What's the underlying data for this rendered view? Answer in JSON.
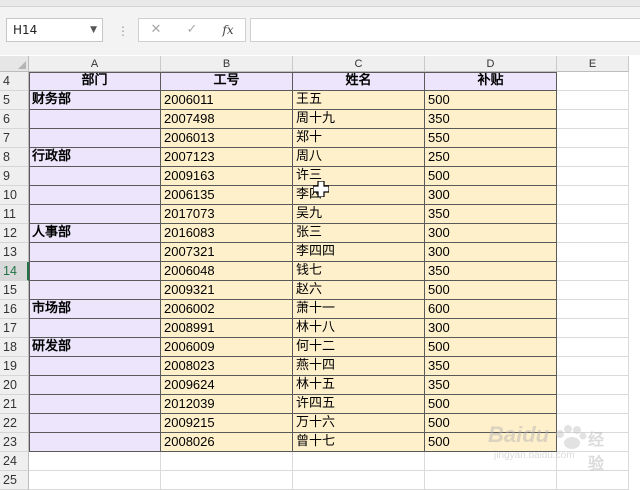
{
  "formula_bar": {
    "name_box": "H14",
    "separator": "⋮",
    "cancel_icon": "close-icon",
    "enter_icon": "check-icon",
    "fx_label": "fx",
    "formula_value": ""
  },
  "columns": [
    "A",
    "B",
    "C",
    "D",
    "E"
  ],
  "rows": [
    "4",
    "5",
    "6",
    "7",
    "8",
    "9",
    "10",
    "11",
    "12",
    "13",
    "14",
    "15",
    "16",
    "17",
    "18",
    "19",
    "20",
    "21",
    "22",
    "23",
    "24",
    "25"
  ],
  "selected_row": "14",
  "table": {
    "headers": [
      "部门",
      "工号",
      "姓名",
      "补贴"
    ],
    "records": [
      {
        "dept": "财务部",
        "id": "2006011",
        "name": "王五",
        "amount": "500"
      },
      {
        "dept": "",
        "id": "2007498",
        "name": "周十九",
        "amount": "350"
      },
      {
        "dept": "",
        "id": "2006013",
        "name": "郑十",
        "amount": "550"
      },
      {
        "dept": "行政部",
        "id": "2007123",
        "name": "周八",
        "amount": "250"
      },
      {
        "dept": "",
        "id": "2009163",
        "name": "许三",
        "amount": "500"
      },
      {
        "dept": "",
        "id": "2006135",
        "name": "李四",
        "amount": "300"
      },
      {
        "dept": "",
        "id": "2017073",
        "name": "吴九",
        "amount": "350"
      },
      {
        "dept": "人事部",
        "id": "2016083",
        "name": "张三",
        "amount": "300"
      },
      {
        "dept": "",
        "id": "2007321",
        "name": "李四四",
        "amount": "300"
      },
      {
        "dept": "",
        "id": "2006048",
        "name": "钱七",
        "amount": "350"
      },
      {
        "dept": "",
        "id": "2009321",
        "name": "赵六",
        "amount": "500"
      },
      {
        "dept": "市场部",
        "id": "2006002",
        "name": "萧十一",
        "amount": "600"
      },
      {
        "dept": "",
        "id": "2008991",
        "name": "林十八",
        "amount": "300"
      },
      {
        "dept": "研发部",
        "id": "2006009",
        "name": "何十二",
        "amount": "500"
      },
      {
        "dept": "",
        "id": "2008023",
        "name": "燕十四",
        "amount": "350"
      },
      {
        "dept": "",
        "id": "2009624",
        "name": "林十五",
        "amount": "350"
      },
      {
        "dept": "",
        "id": "2012039",
        "name": "许四五",
        "amount": "500"
      },
      {
        "dept": "",
        "id": "2009215",
        "name": "万十六",
        "amount": "500"
      },
      {
        "dept": "",
        "id": "2008026",
        "name": "曾十七",
        "amount": "500"
      }
    ]
  },
  "colors": {
    "dept_fill": "#ece5fb",
    "data_fill": "#fff0cc",
    "selection_accent": "#217346"
  },
  "watermark": {
    "brand": "Baidu",
    "cn_text": "经验",
    "sub_text": "jingyan.baidu.com"
  }
}
